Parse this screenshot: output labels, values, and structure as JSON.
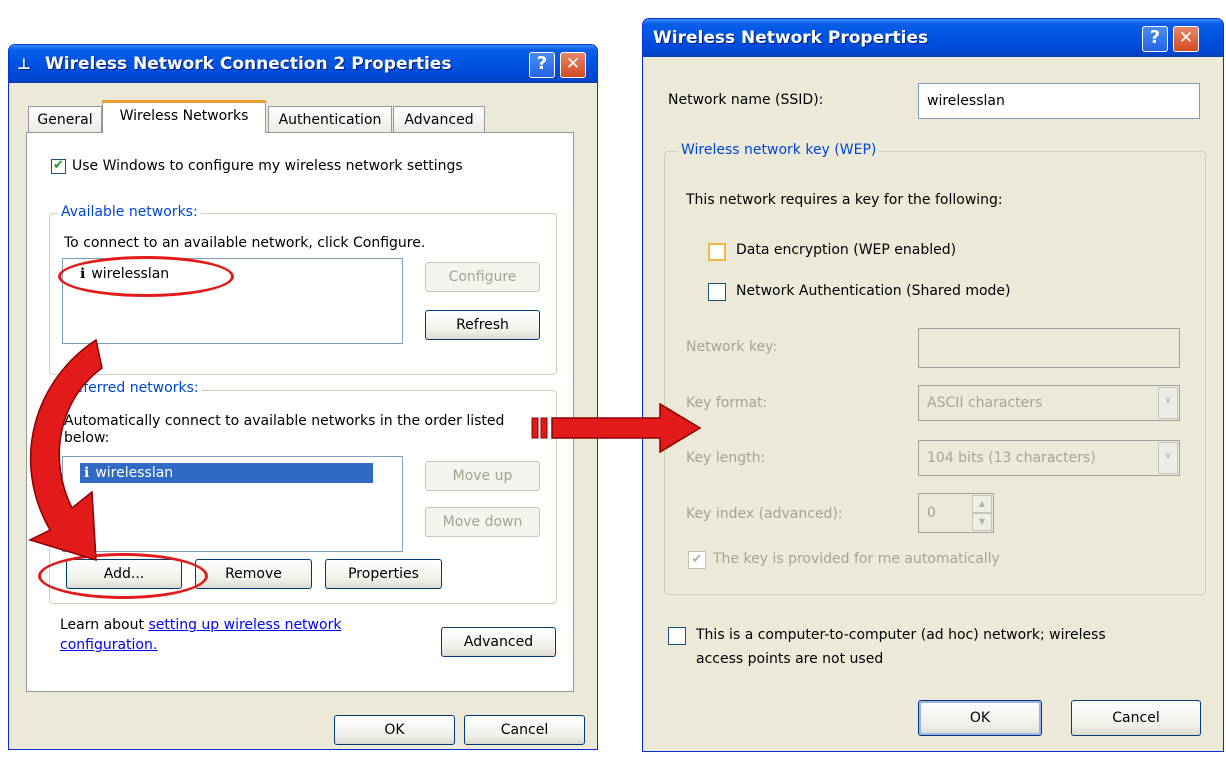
{
  "left_dialog": {
    "title": "Wireless Network Connection 2 Properties",
    "tabs": [
      "General",
      "Wireless Networks",
      "Authentication",
      "Advanced"
    ],
    "use_windows_checkbox": "Use Windows to configure my wireless network settings",
    "available": {
      "group_label": "Available networks:",
      "instruction": "To connect to an available network, click Configure.",
      "networks": [
        "wirelesslan"
      ],
      "configure_button": "Configure",
      "refresh_button": "Refresh"
    },
    "preferred": {
      "group_label": "Preferred networks:",
      "instruction": "Automatically connect to available networks in the order listed below:",
      "networks": [
        "wirelesslan"
      ],
      "move_up_button": "Move up",
      "move_down_button": "Move down",
      "add_button": "Add...",
      "remove_button": "Remove",
      "properties_button": "Properties"
    },
    "learn_about": "Learn about",
    "learn_link_1": "setting up wireless network",
    "learn_link_2": "configuration.",
    "advanced_button": "Advanced",
    "ok_button": "OK",
    "cancel_button": "Cancel"
  },
  "right_dialog": {
    "title": "Wireless Network Properties",
    "ssid_label": "Network name (SSID):",
    "ssid_value": "wirelesslan",
    "wep_group_label": "Wireless network key (WEP)",
    "requires_key": "This network requires a key for the following:",
    "data_encryption": "Data encryption (WEP enabled)",
    "network_auth": "Network Authentication (Shared mode)",
    "network_key_label": "Network key:",
    "key_format_label": "Key format:",
    "key_format_value": "ASCII characters",
    "key_length_label": "Key length:",
    "key_length_value": "104 bits (13 characters)",
    "key_index_label": "Key index (advanced):",
    "key_index_value": "0",
    "auto_key": "The key is provided for me automatically",
    "adhoc_line1": "This is a computer-to-computer (ad hoc) network; wireless",
    "adhoc_line2": "access points are not used",
    "ok_button": "OK",
    "cancel_button": "Cancel"
  },
  "colors": {
    "annotation": "#e21a1a",
    "selection": "#316ac5",
    "link": "#0000ff"
  }
}
